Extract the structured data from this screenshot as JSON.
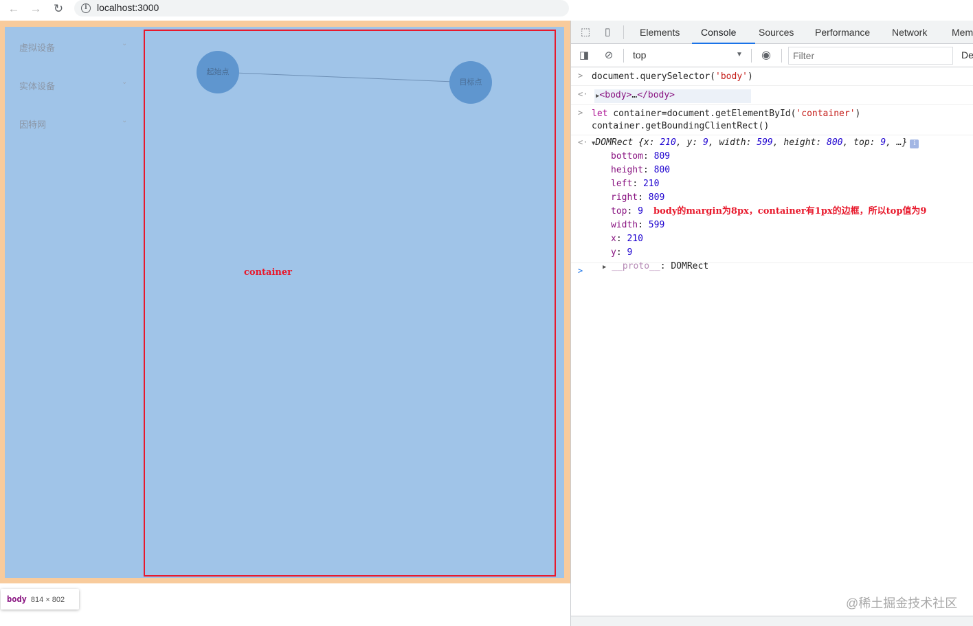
{
  "browser": {
    "url": "localhost:3000",
    "back_icon": "←",
    "forward_icon": "→",
    "reload_icon": "↻",
    "info_icon": "i"
  },
  "page": {
    "sidebar": {
      "items": [
        {
          "label": "虚拟设备",
          "chevron": "⌄"
        },
        {
          "label": "实体设备",
          "chevron": "⌄"
        },
        {
          "label": "因特网",
          "chevron": "⌄"
        }
      ]
    },
    "graph": {
      "start_node": "起始点",
      "target_node": "目标点"
    },
    "container_label": "container",
    "tooltip": {
      "tag": "body",
      "size": "814 × 802"
    }
  },
  "devtools": {
    "tabs": [
      {
        "label": "Elements"
      },
      {
        "label": "Console",
        "active": true
      },
      {
        "label": "Sources"
      },
      {
        "label": "Performance"
      },
      {
        "label": "Network"
      },
      {
        "label": "Mem"
      }
    ],
    "context": "top",
    "filter_placeholder": "Filter",
    "levels": "De",
    "console": {
      "cmd1": {
        "prefix": "document.querySelector(",
        "arg": "'body'",
        "suffix": ")"
      },
      "result1": {
        "open": "<body>",
        "mid": "…",
        "close": "</body>"
      },
      "cmd2": {
        "kw": "let",
        "line1": " container=document.getElementById(",
        "arg": "'container'",
        "suffix": ")",
        "line2": "container.getBoundingClientRect()"
      },
      "domrect": {
        "summary_name": "DOMRect",
        "summary_open": " {",
        "x_key": "x: ",
        "x_val": "210",
        "y_key": ", y: ",
        "y_val": "9",
        "w_key": ", width: ",
        "w_val": "599",
        "h_key": ", height: ",
        "h_val": "800",
        "t_key": ", top: ",
        "t_val": "9",
        "summary_close": ", …}",
        "info": "i",
        "props": [
          {
            "key": "bottom",
            "value": "809"
          },
          {
            "key": "height",
            "value": "800"
          },
          {
            "key": "left",
            "value": "210"
          },
          {
            "key": "right",
            "value": "809"
          },
          {
            "key": "top",
            "value": "9"
          },
          {
            "key": "width",
            "value": "599"
          },
          {
            "key": "x",
            "value": "210"
          },
          {
            "key": "y",
            "value": "9"
          }
        ],
        "proto_key": "__proto__",
        "proto_val": ": DOMRect"
      },
      "annotation": "body的margin为8px，container有1px的边框，所以top值为9",
      "prompt_symbol": ">",
      "result_symbol": "<·"
    }
  },
  "watermark": "@稀土掘金技术社区"
}
